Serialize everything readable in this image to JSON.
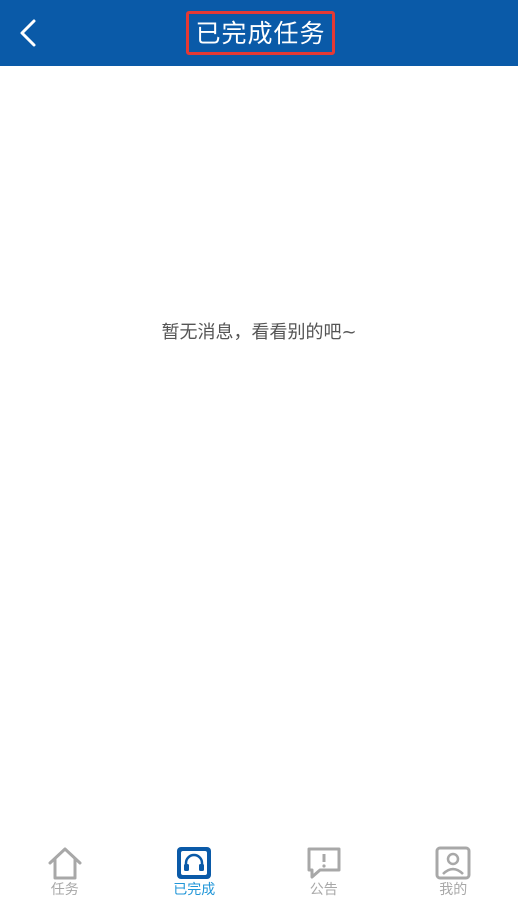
{
  "header": {
    "title": "已完成任务",
    "back_icon": "chevron-left-icon"
  },
  "main": {
    "empty_message": "暂无消息，看看别的吧~"
  },
  "tabbar": {
    "active_color": "#2196d8",
    "inactive_color": "#a8a8a8",
    "items": [
      {
        "label": "任务",
        "icon": "home-icon",
        "active": false
      },
      {
        "label": "已完成",
        "icon": "headset-icon",
        "active": true
      },
      {
        "label": "公告",
        "icon": "announcement-icon",
        "active": false
      },
      {
        "label": "我的",
        "icon": "profile-icon",
        "active": false
      }
    ]
  },
  "colors": {
    "header_bg": "#0a5aa8",
    "highlight_border": "#e53935"
  }
}
